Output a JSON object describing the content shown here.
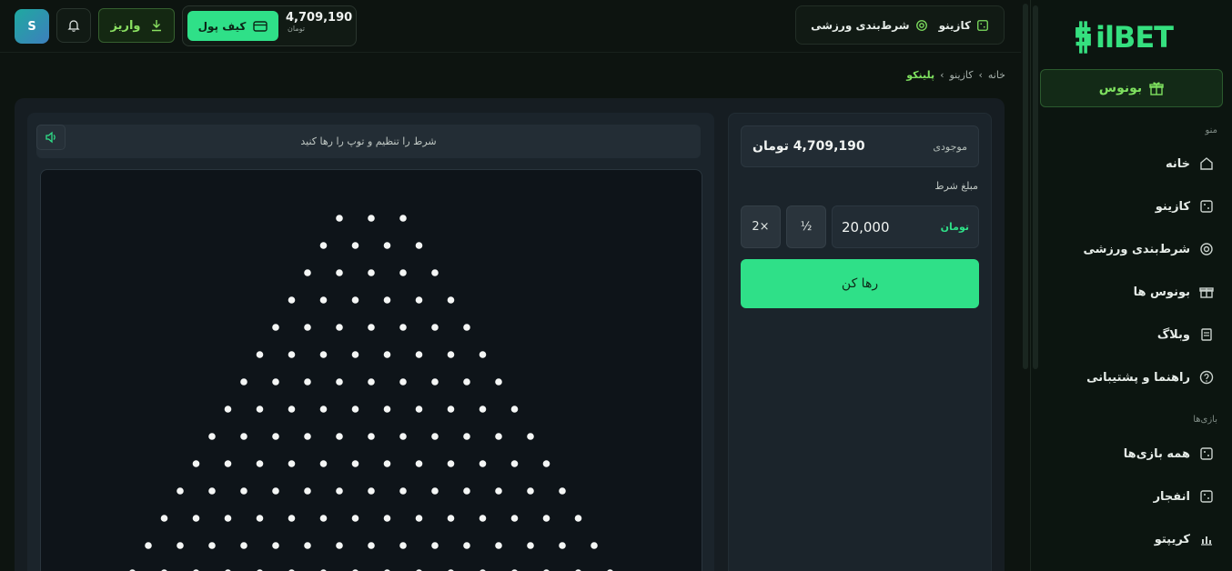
{
  "topbar": {
    "avatar_letter": "S",
    "deposit_label": "واریز",
    "wallet_label": "کیف پول",
    "wallet_amount": "4,709,190",
    "wallet_currency": "تومان",
    "nav": [
      {
        "label": "کازینو",
        "icon": "dice-icon"
      },
      {
        "label": "شرط‌بندی ورزشی",
        "icon": "target-icon"
      }
    ]
  },
  "sidebar": {
    "logo_text": "ilBET",
    "bonus_label": "بونوس",
    "menu_label": "منو",
    "menu": [
      {
        "label": "خانه",
        "icon": "home-icon"
      },
      {
        "label": "کازینو",
        "icon": "dice-icon"
      },
      {
        "label": "شرط‌بندی ورزشی",
        "icon": "target-icon"
      },
      {
        "label": "بونوس ها",
        "icon": "gift-icon"
      },
      {
        "label": "وبلاگ",
        "icon": "document-icon"
      },
      {
        "label": "راهنما و پشتیبانی",
        "icon": "help-icon"
      }
    ],
    "games_label": "بازی‌ها",
    "games": [
      {
        "label": "همه بازی‌ها",
        "icon": "dice-icon"
      },
      {
        "label": "انفجار",
        "icon": "dice-icon"
      },
      {
        "label": "کریپتو",
        "icon": "chart-icon"
      }
    ]
  },
  "breadcrumb": {
    "items": [
      "خانه",
      "کازینو",
      "پلینکو"
    ],
    "separator": "›"
  },
  "game": {
    "hint": "شرط را تنظیم و توپ را رها کنید",
    "balance_label": "موجودی",
    "balance_value": "4,709,190 تومان",
    "bet_label": "مبلغ شرط",
    "bet_amount": "20,000",
    "bet_currency": "تومان",
    "half_label": "½",
    "double_label": "2×",
    "drop_label": "رها کن"
  },
  "colors": {
    "accent": "#2fe088",
    "brand": "#35e07f",
    "bonus_text": "#7ee05f"
  }
}
